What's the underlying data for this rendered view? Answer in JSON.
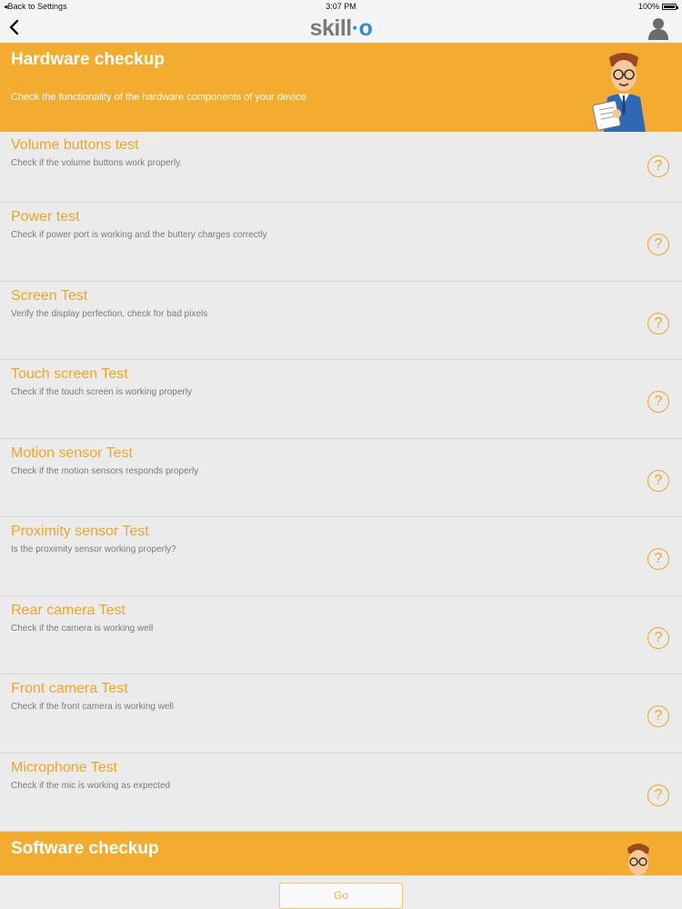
{
  "status_bar": {
    "back_label": "Back to Settings",
    "time": "3:07 PM",
    "battery": "100%"
  },
  "nav": {
    "logo_text": "skill",
    "logo_accent": "o",
    "back_icon": "chevron-left-icon",
    "profile_icon": "person-icon"
  },
  "hardware": {
    "title": "Hardware checkup",
    "subtitle": "Check the functionality of the hardware components of your device",
    "tests": [
      {
        "title": "Volume buttons test",
        "desc": "Check if the volume buttons work properly."
      },
      {
        "title": "Power test",
        "desc": "Check if power port is working and the buttery charges correctly"
      },
      {
        "title": "Screen Test",
        "desc": "Verify the display perfection, check for bad pixels"
      },
      {
        "title": "Touch screen Test",
        "desc": "Check if the touch screen is working properly"
      },
      {
        "title": "Motion sensor Test",
        "desc": "Check if the motion sensors responds properly"
      },
      {
        "title": "Proximity sensor Test",
        "desc": "Is the proximity sensor working properly?"
      },
      {
        "title": "Rear camera Test",
        "desc": "Check if the camera is working well"
      },
      {
        "title": "Front camera Test",
        "desc": "Check if the front camera is working well"
      },
      {
        "title": "Microphone Test",
        "desc": "Check if the mic is working as expected"
      }
    ]
  },
  "software": {
    "title": "Software checkup"
  },
  "help_glyph": "?",
  "go_label": "Go",
  "colors": {
    "accent": "#f3ac2f",
    "title_orange": "#f2a524",
    "logo_blue": "#2d8fd1"
  }
}
